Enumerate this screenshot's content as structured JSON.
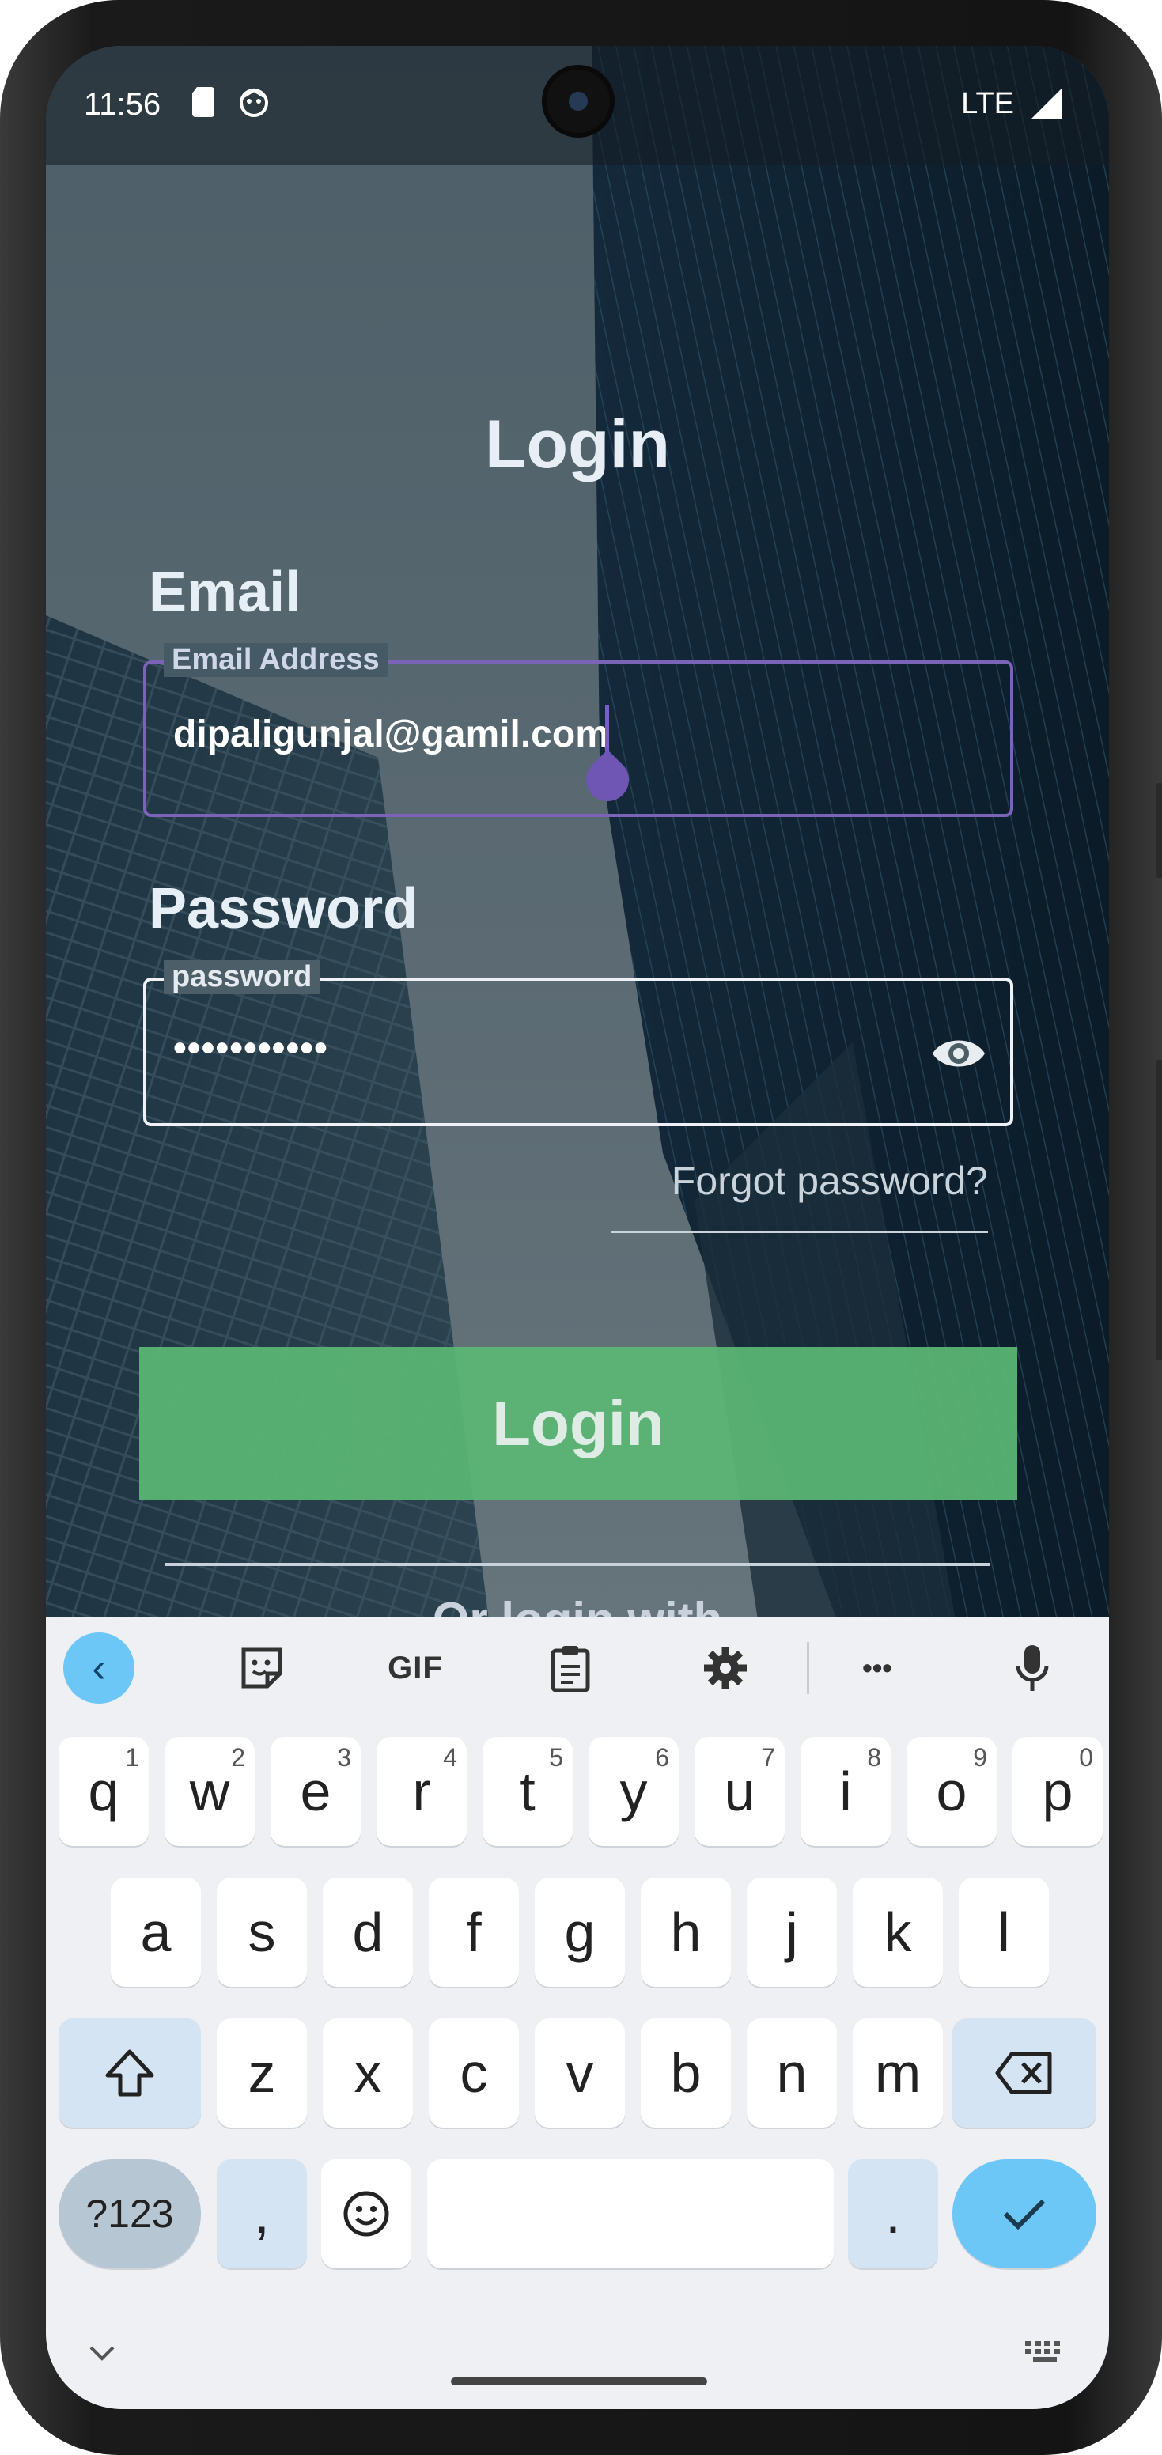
{
  "status_bar": {
    "time": "11:56",
    "network": "LTE"
  },
  "page": {
    "title": "Login"
  },
  "email_section": {
    "label": "Email",
    "legend": "Email Address",
    "value": "dipaligunjal@gamil.com"
  },
  "password_section": {
    "label": "Password",
    "legend": "password",
    "value": "•••••••••••",
    "visibility_icon": "eye-icon"
  },
  "forgot_link": "Forgot password?",
  "login_button": "Login",
  "or_login_with": "Or login with",
  "keyboard": {
    "toolbar": {
      "back": "‹",
      "gif": "GIF",
      "more": "•••"
    },
    "row1": [
      {
        "k": "q",
        "s": "1"
      },
      {
        "k": "w",
        "s": "2"
      },
      {
        "k": "e",
        "s": "3"
      },
      {
        "k": "r",
        "s": "4"
      },
      {
        "k": "t",
        "s": "5"
      },
      {
        "k": "y",
        "s": "6"
      },
      {
        "k": "u",
        "s": "7"
      },
      {
        "k": "i",
        "s": "8"
      },
      {
        "k": "o",
        "s": "9"
      },
      {
        "k": "p",
        "s": "0"
      }
    ],
    "row2": [
      "a",
      "s",
      "d",
      "f",
      "g",
      "h",
      "j",
      "k",
      "l"
    ],
    "row3": [
      "z",
      "x",
      "c",
      "v",
      "b",
      "n",
      "m"
    ],
    "num_key": "?123",
    "comma_key": ",",
    "period_key": ".",
    "accent_color": "#6cc7f7"
  }
}
